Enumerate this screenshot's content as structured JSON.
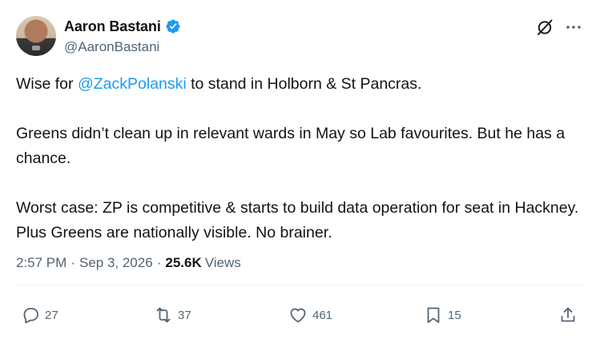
{
  "author": {
    "display_name": "Aaron Bastani",
    "handle": "@AaronBastani",
    "verified": true
  },
  "tweet": {
    "text_line1_before": "Wise for ",
    "mention": "@ZackPolanski",
    "text_line1_after": " to stand in Holborn & St Pancras.",
    "paragraph2": "Greens didn’t clean up in relevant wards in May so Lab favourites. But he has a chance.",
    "paragraph3": "Worst case: ZP is competitive & starts to build data operation for seat in Hackney. Plus Greens are nationally visible. No brainer."
  },
  "meta": {
    "time": "2:57 PM",
    "separator": "·",
    "date": "Sep 3, 2026",
    "views_count": "25.6K",
    "views_label": "Views"
  },
  "actions": {
    "replies": "27",
    "reposts": "37",
    "likes": "461",
    "bookmarks": "15"
  },
  "colors": {
    "accent": "#1d9bf0",
    "text": "#0f1419",
    "muted": "#536471",
    "divider": "#eff3f4"
  },
  "icons": [
    "verified-badge-icon",
    "grok-icon",
    "more-icon",
    "reply-icon",
    "repost-icon",
    "like-icon",
    "bookmark-icon",
    "share-icon"
  ]
}
